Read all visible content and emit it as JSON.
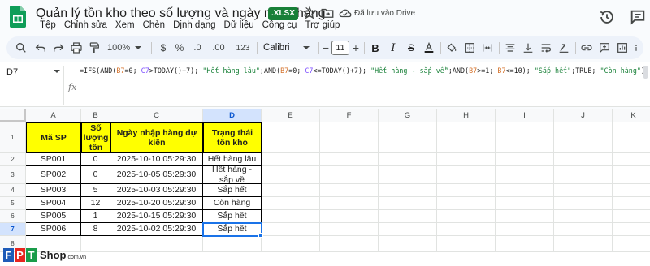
{
  "doc": {
    "title": "Quản lý tồn kho theo số lượng và ngày nhập hàng",
    "format_badge": ".XLSX",
    "save_status": "Đã lưu vào Drive"
  },
  "menu": [
    "Tệp",
    "Chỉnh sửa",
    "Xem",
    "Chèn",
    "Định dạng",
    "Dữ liệu",
    "Công cụ",
    "Trợ giúp"
  ],
  "toolbar": {
    "zoom": "100%",
    "currency": "$",
    "percent": "%",
    "decimal_decrease": ".0",
    "decimal_increase": ".00",
    "number_format": "123",
    "font": "Calibri",
    "font_size": "11"
  },
  "formula_bar": {
    "name_box": "D7",
    "formula_parts": [
      {
        "t": "=IFS(AND(",
        "c": ""
      },
      {
        "t": "B7",
        "c": "ref1"
      },
      {
        "t": "=0; ",
        "c": ""
      },
      {
        "t": "C7",
        "c": "ref2"
      },
      {
        "t": ">TODAY()+7); ",
        "c": ""
      },
      {
        "t": "\"Hết hàng lâu\"",
        "c": "str"
      },
      {
        "t": ";AND(",
        "c": ""
      },
      {
        "t": "B7",
        "c": "ref1"
      },
      {
        "t": "=0; ",
        "c": ""
      },
      {
        "t": "C7",
        "c": "ref2"
      },
      {
        "t": "<=TODAY()+7); ",
        "c": ""
      },
      {
        "t": "\"Hết hàng - sắp về\"",
        "c": "str"
      },
      {
        "t": ";AND(",
        "c": ""
      },
      {
        "t": "B7",
        "c": "ref1"
      },
      {
        "t": ">=1; ",
        "c": ""
      },
      {
        "t": "B7",
        "c": "ref1"
      },
      {
        "t": "<=10); ",
        "c": ""
      },
      {
        "t": "\"Sắp hết\"",
        "c": "str"
      },
      {
        "t": ";TRUE; ",
        "c": ""
      },
      {
        "t": "\"Còn hàng\"",
        "c": "str"
      },
      {
        "t": ")",
        "c": ""
      }
    ]
  },
  "grid": {
    "columns": [
      "A",
      "B",
      "C",
      "D",
      "E",
      "F",
      "G",
      "H",
      "I",
      "J",
      "K"
    ],
    "active_column": "D",
    "active_row": "7",
    "row_numbers": [
      "1",
      "2",
      "3",
      "4",
      "5",
      "6",
      "7",
      "8"
    ],
    "headers": [
      "Mã SP",
      "Số lượng tồn",
      "Ngày nhập hàng dự kiến",
      "Trạng thái tồn kho"
    ],
    "rows": [
      [
        "SP001",
        "0",
        "2025-10-10 05:29:30",
        "Hết hàng lâu"
      ],
      [
        "SP002",
        "0",
        "2025-10-05 05:29:30",
        "Hết hàng - sắp về"
      ],
      [
        "SP003",
        "5",
        "2025-10-03 05:29:30",
        "Sắp hết"
      ],
      [
        "SP004",
        "12",
        "2025-10-20 05:29:30",
        "Còn hàng"
      ],
      [
        "SP005",
        "1",
        "2025-10-15 05:29:30",
        "Sắp hết"
      ],
      [
        "SP006",
        "8",
        "2025-10-02 05:29:30",
        "Sắp hết"
      ]
    ]
  },
  "watermark": {
    "letters": [
      "F",
      "P",
      "T"
    ],
    "brand": "Shop",
    "domain": ".com.vn",
    "colors": [
      "#1e5bb8",
      "#e8251f",
      "#1a9c4a"
    ]
  }
}
